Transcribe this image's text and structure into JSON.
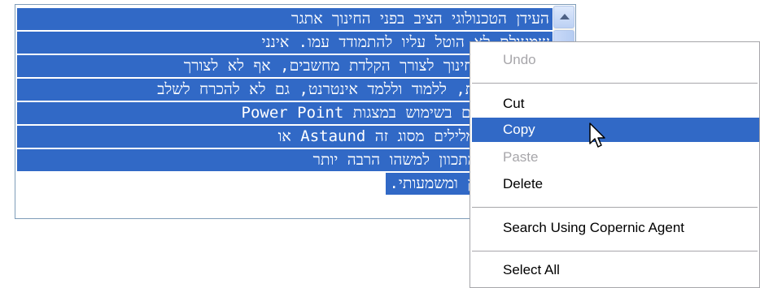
{
  "textarea": {
    "lines": [
      "העידן הטכנולוגי הציב בפני החינוך אתגר",
      "שמעולם לא הוטל עליו להתמודד עמו. אינני",
      "חושב שיש חינוך לצורך הקלדת מחשבים, אף לא לצורך",
      "להכיר תוכנות, ללמוד וללמד אינטרנט, גם לא להכרח לשלב",
      "את התלמידים בשימוש במצגות Power Point",
      "או מעבד תמלילים מסוג זה Astaund או",
      "אחר. אני מתכוון למשהו הרבה יותר",
      "בסיסי, עמוק ומשמעותי."
    ],
    "selection_color": "#3169c6"
  },
  "context_menu": {
    "items": {
      "undo": "Undo",
      "cut": "Cut",
      "copy": "Copy",
      "paste": "Paste",
      "delete": "Delete",
      "search": "Search Using Copernic Agent",
      "select_all": "Select All"
    },
    "highlighted": "Copy",
    "highlight_color": "#3169c6",
    "disabled_color": "#a7a6aa"
  },
  "icons": {
    "scroll_up": "chevron-up-icon",
    "cursor": "arrow-cursor-icon"
  }
}
